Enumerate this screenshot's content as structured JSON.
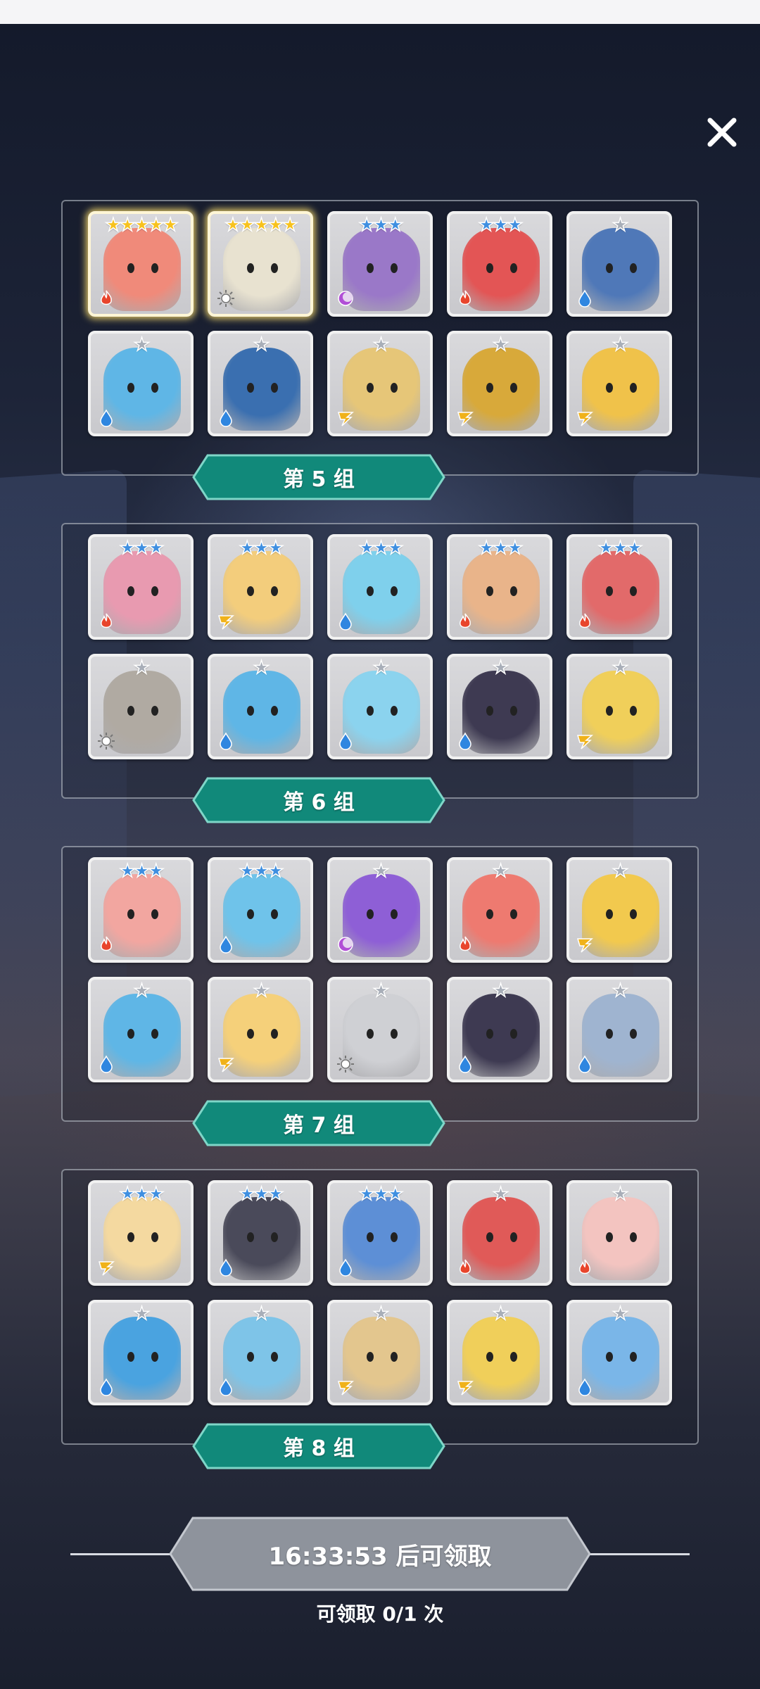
{
  "colors": {
    "banner_fill": "#11897a",
    "banner_border": "#7fd6c8",
    "star_gold": "#f7c21e",
    "star_blue": "#3f8fe0",
    "star_silver": "#a8aeb8",
    "claim_button": "#8e939c"
  },
  "close": {
    "icon": "close-icon"
  },
  "groups": [
    {
      "label": "第 5 组",
      "cards": [
        {
          "stars": 5,
          "rarity": "gold",
          "element": "fire",
          "body": "#f08a7a"
        },
        {
          "stars": 5,
          "rarity": "gold",
          "element": "light",
          "body": "#e8e2d0"
        },
        {
          "stars": 3,
          "rarity": "blue",
          "element": "dark",
          "body": "#9a78c8"
        },
        {
          "stars": 3,
          "rarity": "blue",
          "element": "fire",
          "body": "#e35555"
        },
        {
          "stars": 1,
          "rarity": "silver",
          "element": "water",
          "body": "#4f78b8"
        },
        {
          "stars": 1,
          "rarity": "silver",
          "element": "water",
          "body": "#5fb6e6"
        },
        {
          "stars": 1,
          "rarity": "silver",
          "element": "water",
          "body": "#3a6fb0"
        },
        {
          "stars": 1,
          "rarity": "silver",
          "element": "thunder",
          "body": "#e6c678"
        },
        {
          "stars": 1,
          "rarity": "silver",
          "element": "thunder",
          "body": "#d8a93a"
        },
        {
          "stars": 1,
          "rarity": "silver",
          "element": "thunder",
          "body": "#f0c24a"
        }
      ]
    },
    {
      "label": "第 6 组",
      "cards": [
        {
          "stars": 3,
          "rarity": "blue",
          "element": "fire",
          "body": "#e89ab0"
        },
        {
          "stars": 3,
          "rarity": "blue",
          "element": "thunder",
          "body": "#f3cd7c"
        },
        {
          "stars": 3,
          "rarity": "blue",
          "element": "water",
          "body": "#7fd0ec"
        },
        {
          "stars": 3,
          "rarity": "blue",
          "element": "fire",
          "body": "#e9b48a"
        },
        {
          "stars": 3,
          "rarity": "blue",
          "element": "fire",
          "body": "#e26a6a"
        },
        {
          "stars": 1,
          "rarity": "silver",
          "element": "light",
          "body": "#b0aaa2"
        },
        {
          "stars": 1,
          "rarity": "silver",
          "element": "water",
          "body": "#5fb6e6"
        },
        {
          "stars": 1,
          "rarity": "silver",
          "element": "water",
          "body": "#8bd3ee"
        },
        {
          "stars": 1,
          "rarity": "silver",
          "element": "water",
          "body": "#3e3a52"
        },
        {
          "stars": 1,
          "rarity": "silver",
          "element": "thunder",
          "body": "#f0cf5a"
        }
      ]
    },
    {
      "label": "第 7 组",
      "cards": [
        {
          "stars": 3,
          "rarity": "blue",
          "element": "fire",
          "body": "#f2a6a0"
        },
        {
          "stars": 3,
          "rarity": "blue",
          "element": "water",
          "body": "#6fc3ea"
        },
        {
          "stars": 1,
          "rarity": "silver",
          "element": "dark",
          "body": "#8e5fd6"
        },
        {
          "stars": 1,
          "rarity": "silver",
          "element": "fire",
          "body": "#ee7a70"
        },
        {
          "stars": 1,
          "rarity": "silver",
          "element": "thunder",
          "body": "#f2c94e"
        },
        {
          "stars": 1,
          "rarity": "silver",
          "element": "water",
          "body": "#5fb6e6"
        },
        {
          "stars": 1,
          "rarity": "silver",
          "element": "thunder",
          "body": "#f5d07a"
        },
        {
          "stars": 1,
          "rarity": "silver",
          "element": "light",
          "body": "#cfd0d4"
        },
        {
          "stars": 1,
          "rarity": "silver",
          "element": "water",
          "body": "#3e3a52"
        },
        {
          "stars": 1,
          "rarity": "silver",
          "element": "water",
          "body": "#9fb4d0"
        }
      ]
    },
    {
      "label": "第 8 组",
      "cards": [
        {
          "stars": 3,
          "rarity": "blue",
          "element": "thunder",
          "body": "#f4d9a0"
        },
        {
          "stars": 3,
          "rarity": "blue",
          "element": "water",
          "body": "#4a4a5a"
        },
        {
          "stars": 3,
          "rarity": "blue",
          "element": "water",
          "body": "#5d8fd6"
        },
        {
          "stars": 1,
          "rarity": "silver",
          "element": "fire",
          "body": "#e05a58"
        },
        {
          "stars": 1,
          "rarity": "silver",
          "element": "fire",
          "body": "#f3c4c0"
        },
        {
          "stars": 1,
          "rarity": "silver",
          "element": "water",
          "body": "#4aa3e0"
        },
        {
          "stars": 1,
          "rarity": "silver",
          "element": "water",
          "body": "#7ec4e8"
        },
        {
          "stars": 1,
          "rarity": "silver",
          "element": "thunder",
          "body": "#e3c68e"
        },
        {
          "stars": 1,
          "rarity": "silver",
          "element": "thunder",
          "body": "#f0cf5a"
        },
        {
          "stars": 1,
          "rarity": "silver",
          "element": "water",
          "body": "#7ab6e8"
        }
      ]
    }
  ],
  "claim": {
    "button_label": "16:33:53 后可领取",
    "count_label": "可领取 0/1 次"
  }
}
